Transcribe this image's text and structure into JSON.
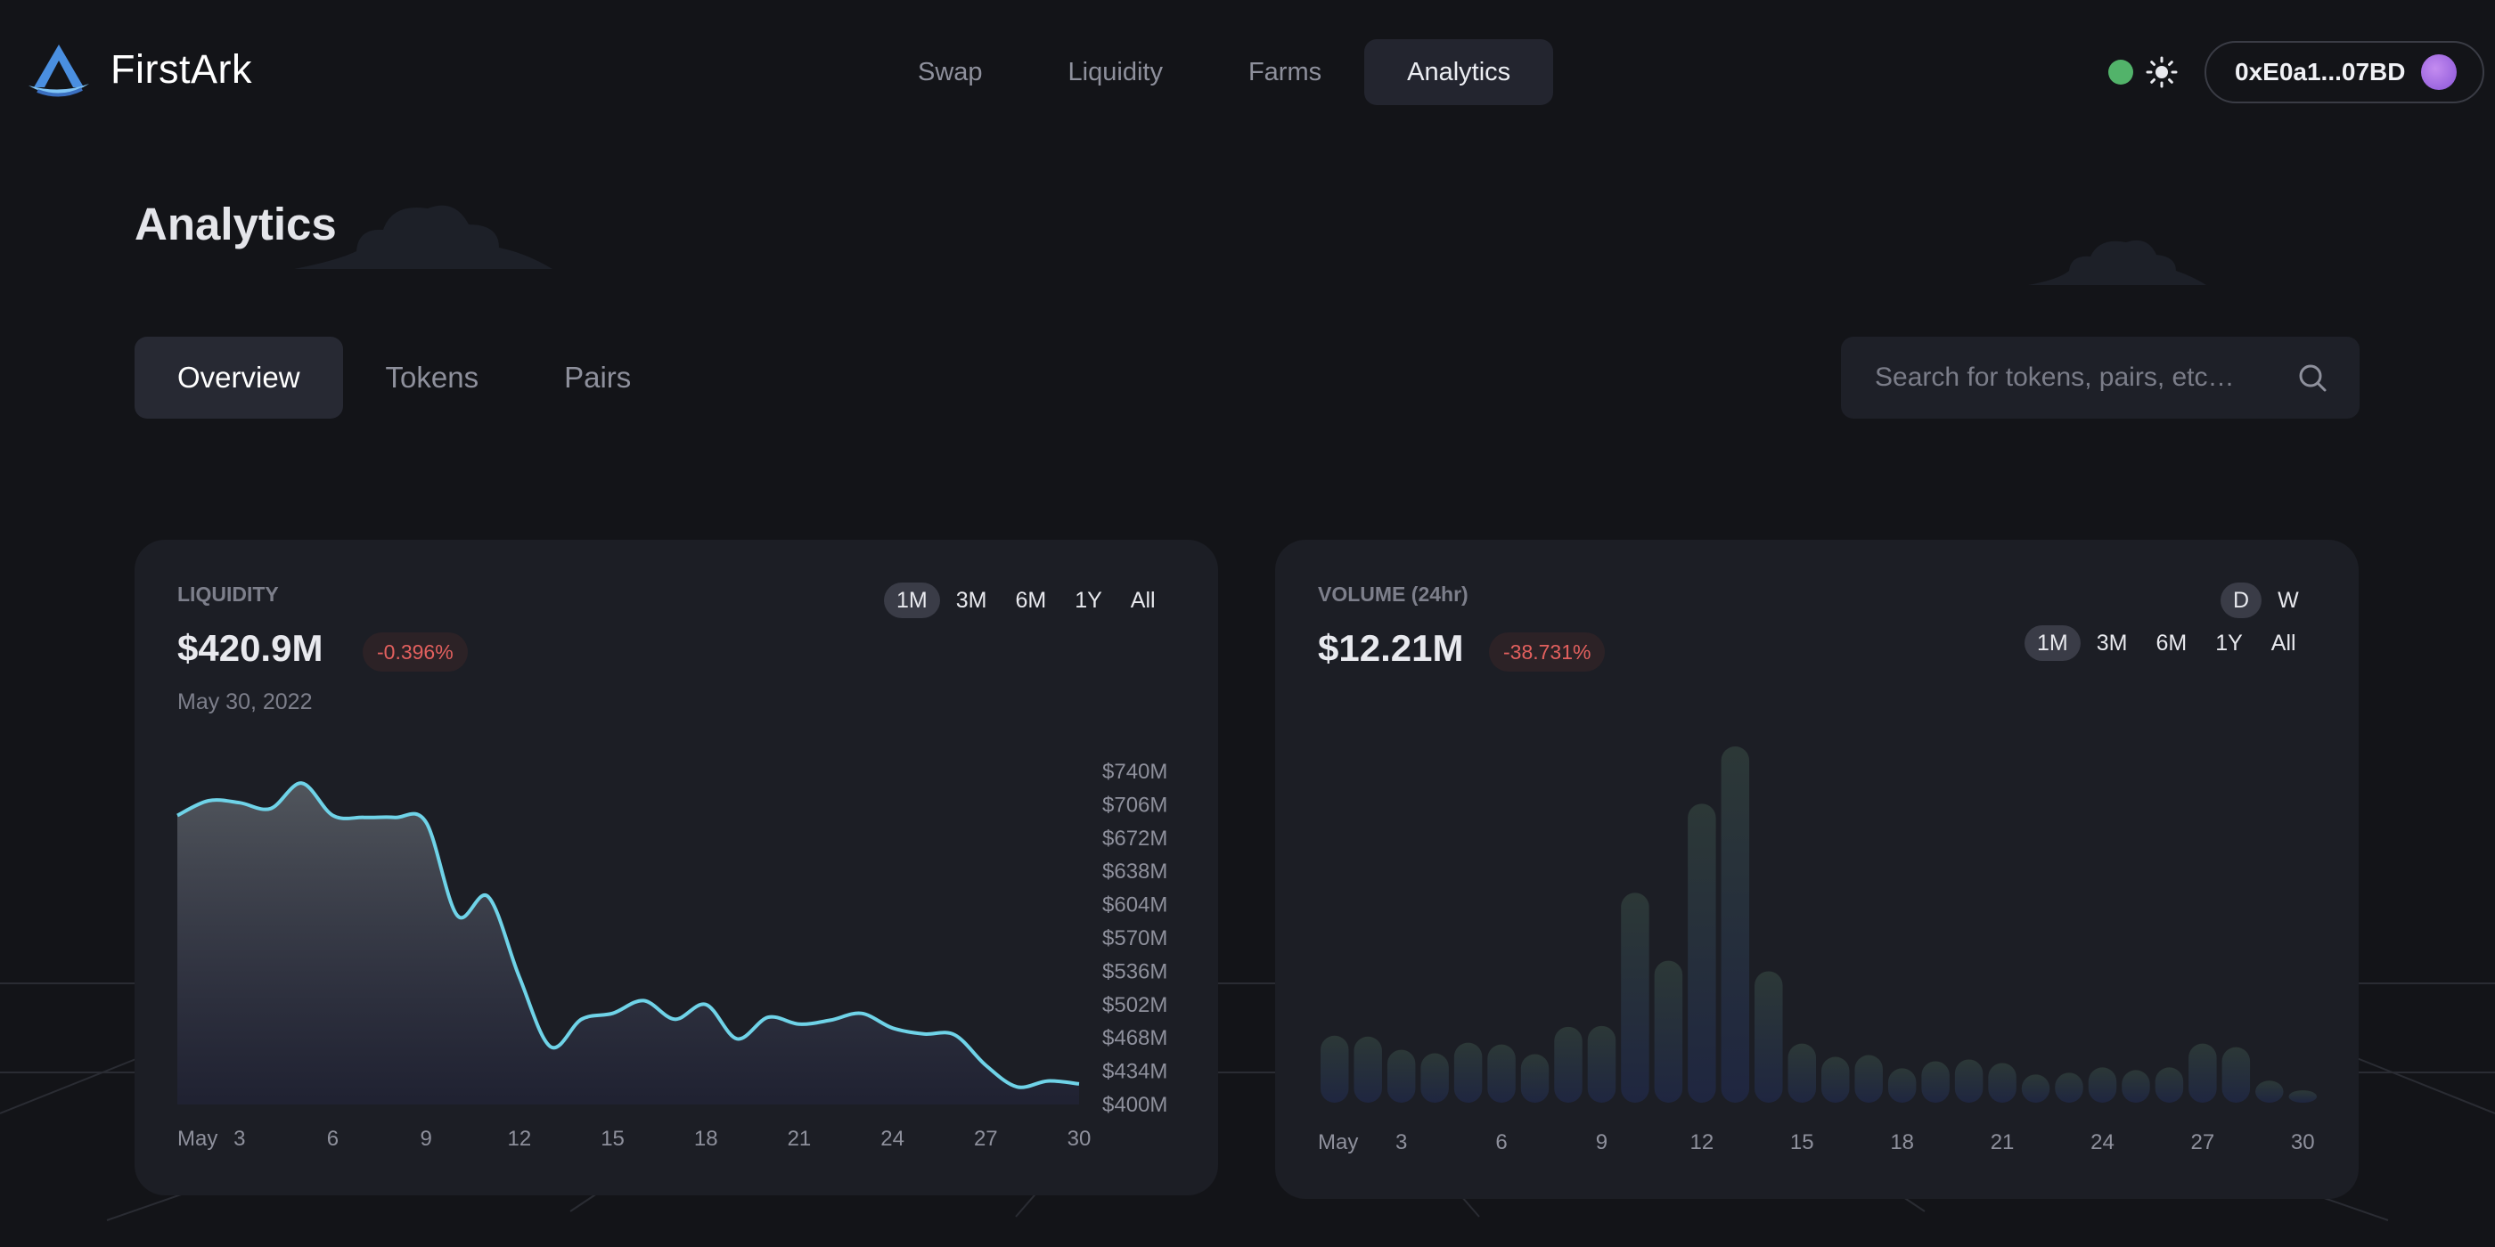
{
  "header": {
    "brand": "FirstArk",
    "nav": [
      "Swap",
      "Liquidity",
      "Farms",
      "Analytics"
    ],
    "active_nav": "Analytics",
    "wallet_address": "0xE0a1...07BD"
  },
  "page": {
    "title": "Analytics",
    "tabs": [
      "Overview",
      "Tokens",
      "Pairs"
    ],
    "active_tab": "Overview",
    "search_placeholder": "Search for tokens, pairs, etc…"
  },
  "colors": {
    "accent_line": "#6fd3e8",
    "negative": "#e2605e",
    "status_online": "#52b36a"
  },
  "liquidity_card": {
    "label": "LIQUIDITY",
    "value": "$420.9M",
    "change": "-0.396%",
    "date": "May 30, 2022",
    "ranges": [
      "1M",
      "3M",
      "6M",
      "1Y",
      "All"
    ],
    "active_range": "1M"
  },
  "volume_card": {
    "label": "VOLUME (24hr)",
    "value": "$12.21M",
    "change": "-38.731%",
    "interval": [
      "D",
      "W"
    ],
    "active_interval": "D",
    "ranges": [
      "1M",
      "3M",
      "6M",
      "1Y",
      "All"
    ],
    "active_range": "1M"
  },
  "chart_data": [
    {
      "type": "area",
      "series_name": "Liquidity",
      "x_ticks": [
        "May",
        "3",
        "6",
        "9",
        "12",
        "15",
        "18",
        "21",
        "24",
        "27",
        "30"
      ],
      "y_ticks": [
        "$740M",
        "$706M",
        "$672M",
        "$638M",
        "$604M",
        "$570M",
        "$536M",
        "$502M",
        "$468M",
        "$434M",
        "$400M"
      ],
      "ylim": [
        400,
        740
      ],
      "x": [
        "May 1",
        "May 2",
        "May 3",
        "May 4",
        "May 5",
        "May 6",
        "May 7",
        "May 8",
        "May 9",
        "May 10",
        "May 11",
        "May 12",
        "May 13",
        "May 14",
        "May 15",
        "May 16",
        "May 17",
        "May 18",
        "May 19",
        "May 20",
        "May 21",
        "May 22",
        "May 23",
        "May 24",
        "May 25",
        "May 26",
        "May 27",
        "May 28",
        "May 29",
        "May 30"
      ],
      "values": [
        695,
        710,
        708,
        702,
        728,
        695,
        693,
        693,
        688,
        593,
        612,
        530,
        459,
        487,
        493,
        506,
        487,
        502,
        467,
        489,
        482,
        486,
        493,
        478,
        472,
        471,
        440,
        418,
        424,
        421
      ]
    },
    {
      "type": "bar",
      "series_name": "Volume (24hr)",
      "x_ticks": [
        "May",
        "3",
        "6",
        "9",
        "12",
        "15",
        "18",
        "21",
        "24",
        "27",
        "30"
      ],
      "categories": [
        "May 1",
        "May 2",
        "May 3",
        "May 4",
        "May 5",
        "May 6",
        "May 7",
        "May 8",
        "May 9",
        "May 10",
        "May 11",
        "May 12",
        "May 13",
        "May 14",
        "May 15",
        "May 16",
        "May 17",
        "May 18",
        "May 19",
        "May 20",
        "May 21",
        "May 22",
        "May 23",
        "May 24",
        "May 25",
        "May 26",
        "May 27",
        "May 28",
        "May 29",
        "May 30"
      ],
      "values": [
        76,
        75,
        60,
        56,
        68,
        66,
        55,
        86,
        87,
        238,
        161,
        339,
        404,
        149,
        67,
        52,
        54,
        39,
        47,
        49,
        45,
        32,
        34,
        40,
        37,
        40,
        67,
        63,
        25,
        14
      ],
      "unit": "relative"
    }
  ]
}
